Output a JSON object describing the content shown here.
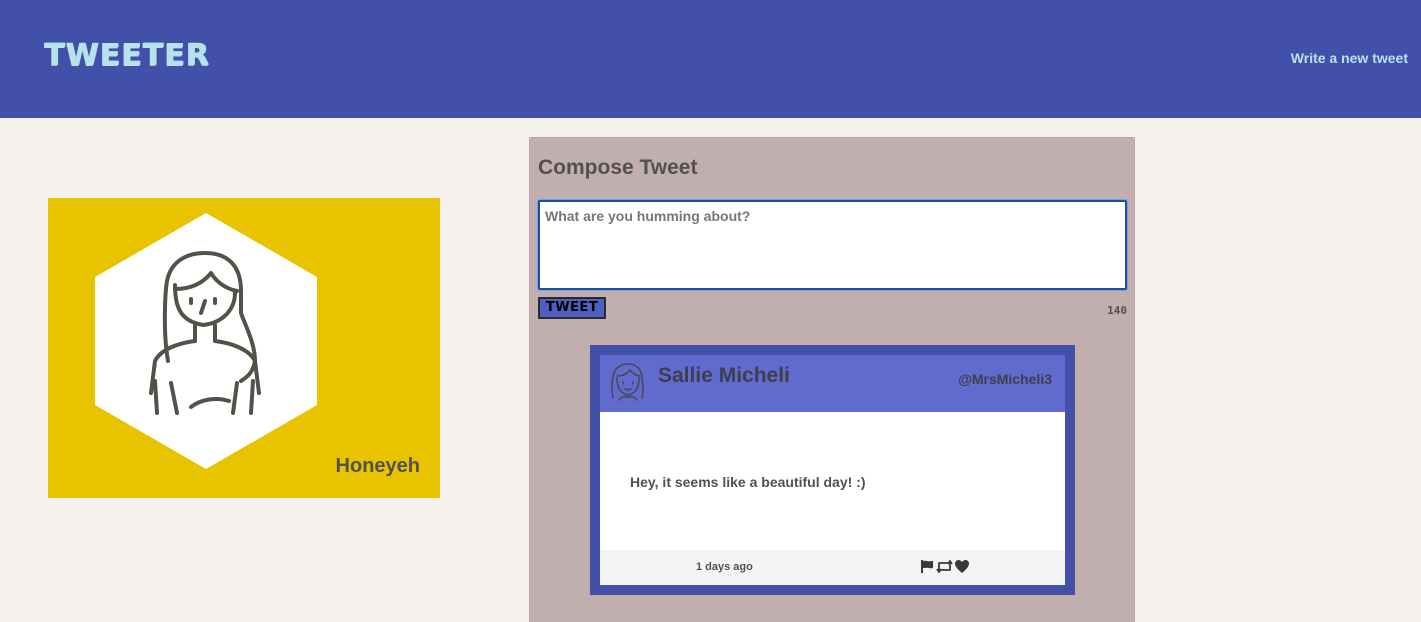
{
  "nav": {
    "logo": "TWEETER",
    "write_link": "Write a new tweet"
  },
  "profile": {
    "name": "Honeyeh",
    "avatar_icon": "woman-avatar-icon",
    "background": "#e7c300"
  },
  "compose": {
    "title": "Compose Tweet",
    "placeholder": "What are you humming about?",
    "value": "",
    "button_label": "TWEET",
    "counter": "140"
  },
  "tweets": [
    {
      "name": "Sallie Micheli",
      "handle": "@MrsMicheli3",
      "text": "Hey, it seems like a beautiful day! :)",
      "time": "1 days ago",
      "actions": [
        "flag-icon",
        "retweet-icon",
        "heart-icon"
      ]
    }
  ],
  "colors": {
    "nav": "#4350aa",
    "accent_text": "#b6e2ec",
    "main_panel": "#c1afaf",
    "tweet_header": "#606bcd"
  }
}
